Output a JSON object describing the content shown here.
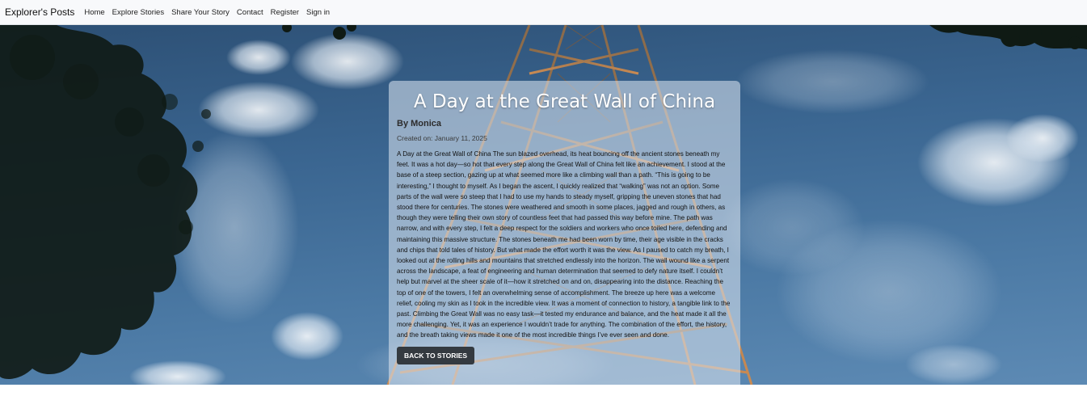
{
  "nav": {
    "brand": "Explorer's Posts",
    "links": [
      "Home",
      "Explore Stories",
      "Share Your Story",
      "Contact",
      "Register",
      "Sign in"
    ]
  },
  "story": {
    "title": "A Day at the Great Wall of China",
    "author": "By Monica",
    "created": "Created on: January 11, 2025",
    "body": "A Day at the Great Wall of China The sun blazed overhead, its heat bouncing off the ancient stones beneath my feet. It was a hot day—so hot that every step along the Great Wall of China felt like an achievement. I stood at the base of a steep section, gazing up at what seemed more like a climbing wall than a path. “This is going to be interesting,” I thought to myself. As I began the ascent, I quickly realized that “walking” was not an option. Some parts of the wall were so steep that I had to use my hands to steady myself, gripping the uneven stones that had stood there for centuries. The stones were weathered and smooth in some places, jagged and rough in others, as though they were telling their own story of countless feet that had passed this way before mine. The path was narrow, and with every step, I felt a deep respect for the soldiers and workers who once toiled here, defending and maintaining this massive structure. The stones beneath me had been worn by time, their age visible in the cracks and chips that told tales of history. But what made the effort worth it was the view. As I paused to catch my breath, I looked out at the rolling hills and mountains that stretched endlessly into the horizon. The wall wound like a serpent across the landscape, a feat of engineering and human determination that seemed to defy nature itself. I couldn’t help but marvel at the sheer scale of it—how it stretched on and on, disappearing into the distance. Reaching the top of one of the towers, I felt an overwhelming sense of accomplishment. The breeze up here was a welcome relief, cooling my skin as I took in the incredible view. It was a moment of connection to history, a tangible link to the past. Climbing the Great Wall was no easy task—it tested my endurance and balance, and the heat made it all the more challenging. Yet, it was an experience I wouldn’t trade for anything. The combination of the effort, the history, and the breath taking views made it one of the most incredible things I’ve ever seen and done.",
    "back_label": "BACK TO STORIES"
  },
  "colors": {
    "sky": "#3a6590",
    "button": "#343a40",
    "navbar": "#f8f9fb"
  }
}
